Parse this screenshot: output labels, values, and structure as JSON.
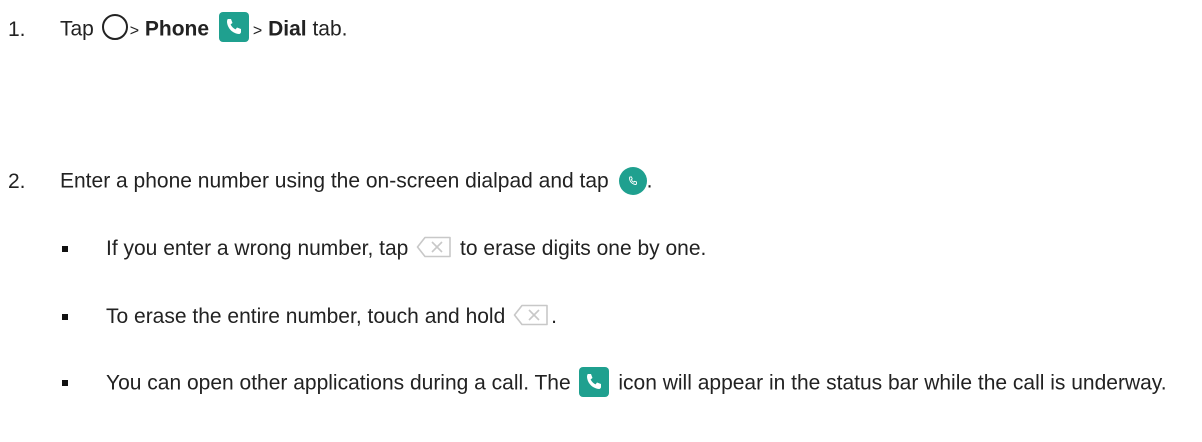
{
  "step1": {
    "number": "1.",
    "tap": "Tap",
    "sep1": ">",
    "phone": "Phone",
    "sep2": ">",
    "dial": "Dial",
    "tab": "tab."
  },
  "step2": {
    "number": "2.",
    "text": "Enter a phone number using the on-screen dialpad and tap",
    "end": "."
  },
  "bullets": {
    "b1_before": "If you enter a wrong number, tap",
    "b1_after": "to erase digits one by one.",
    "b2_before": "To erase the entire number, touch and hold",
    "b2_after": ".",
    "b3_before": "You can open other applications during a call. The",
    "b3_after": "icon will appear in the status bar while the call is underway."
  },
  "icons": {
    "home": "home-circle-icon",
    "phone_app": "phone-app-icon",
    "call": "call-button-icon",
    "backspace": "backspace-icon",
    "status_call": "phone-status-icon"
  },
  "colors": {
    "teal": "#1fa08f",
    "teal_dark": "#178f7f",
    "icon_gray": "#c8c8c8"
  }
}
